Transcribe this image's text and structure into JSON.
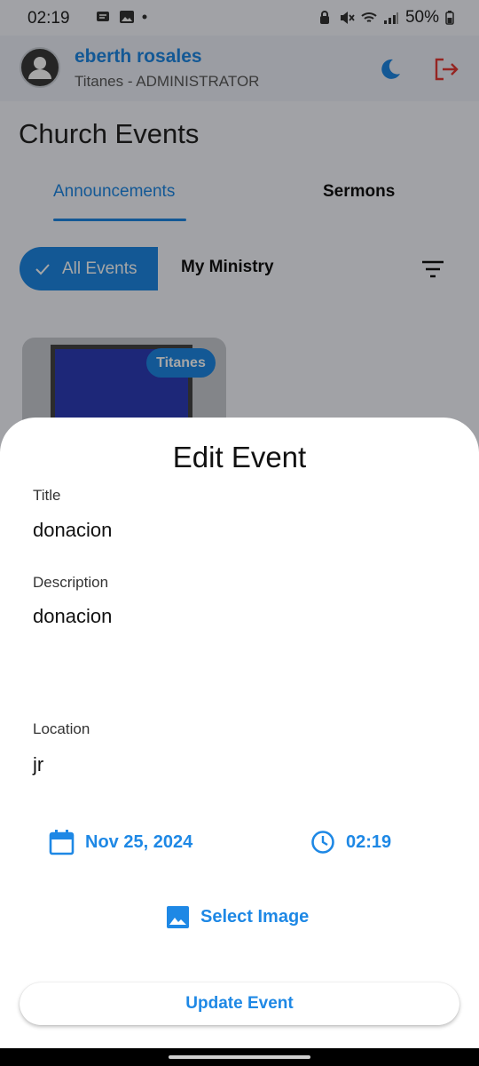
{
  "status_bar": {
    "time": "02:19",
    "battery": "50%",
    "left_icons": [
      "notification-icon",
      "image-icon",
      "dot-icon"
    ],
    "right_icons": [
      "lock-icon",
      "mute-icon",
      "wifi-icon",
      "signal-icon",
      "battery-icon"
    ]
  },
  "header": {
    "user_name": "eberth rosales",
    "user_role": "Titanes - ADMINISTRATOR"
  },
  "page": {
    "title": "Church Events",
    "tabs": [
      {
        "label": "Announcements",
        "selected": true
      },
      {
        "label": "Sermons",
        "selected": false
      }
    ],
    "filters": {
      "all_events": "All Events",
      "my_ministry": "My Ministry"
    },
    "card": {
      "badge": "Titanes"
    }
  },
  "sheet": {
    "title": "Edit Event",
    "fields": [
      {
        "label": "Title",
        "value": "donacion"
      },
      {
        "label": "Description",
        "value": "donacion"
      },
      {
        "label": "Location",
        "value": "jr"
      }
    ],
    "date": "Nov 25, 2024",
    "time": "02:19",
    "select_image": "Select Image",
    "update_button": "Update Event"
  },
  "colors": {
    "accent": "#1e88e5",
    "logout": "#e53935",
    "sheet_bg": "#ffffff"
  }
}
